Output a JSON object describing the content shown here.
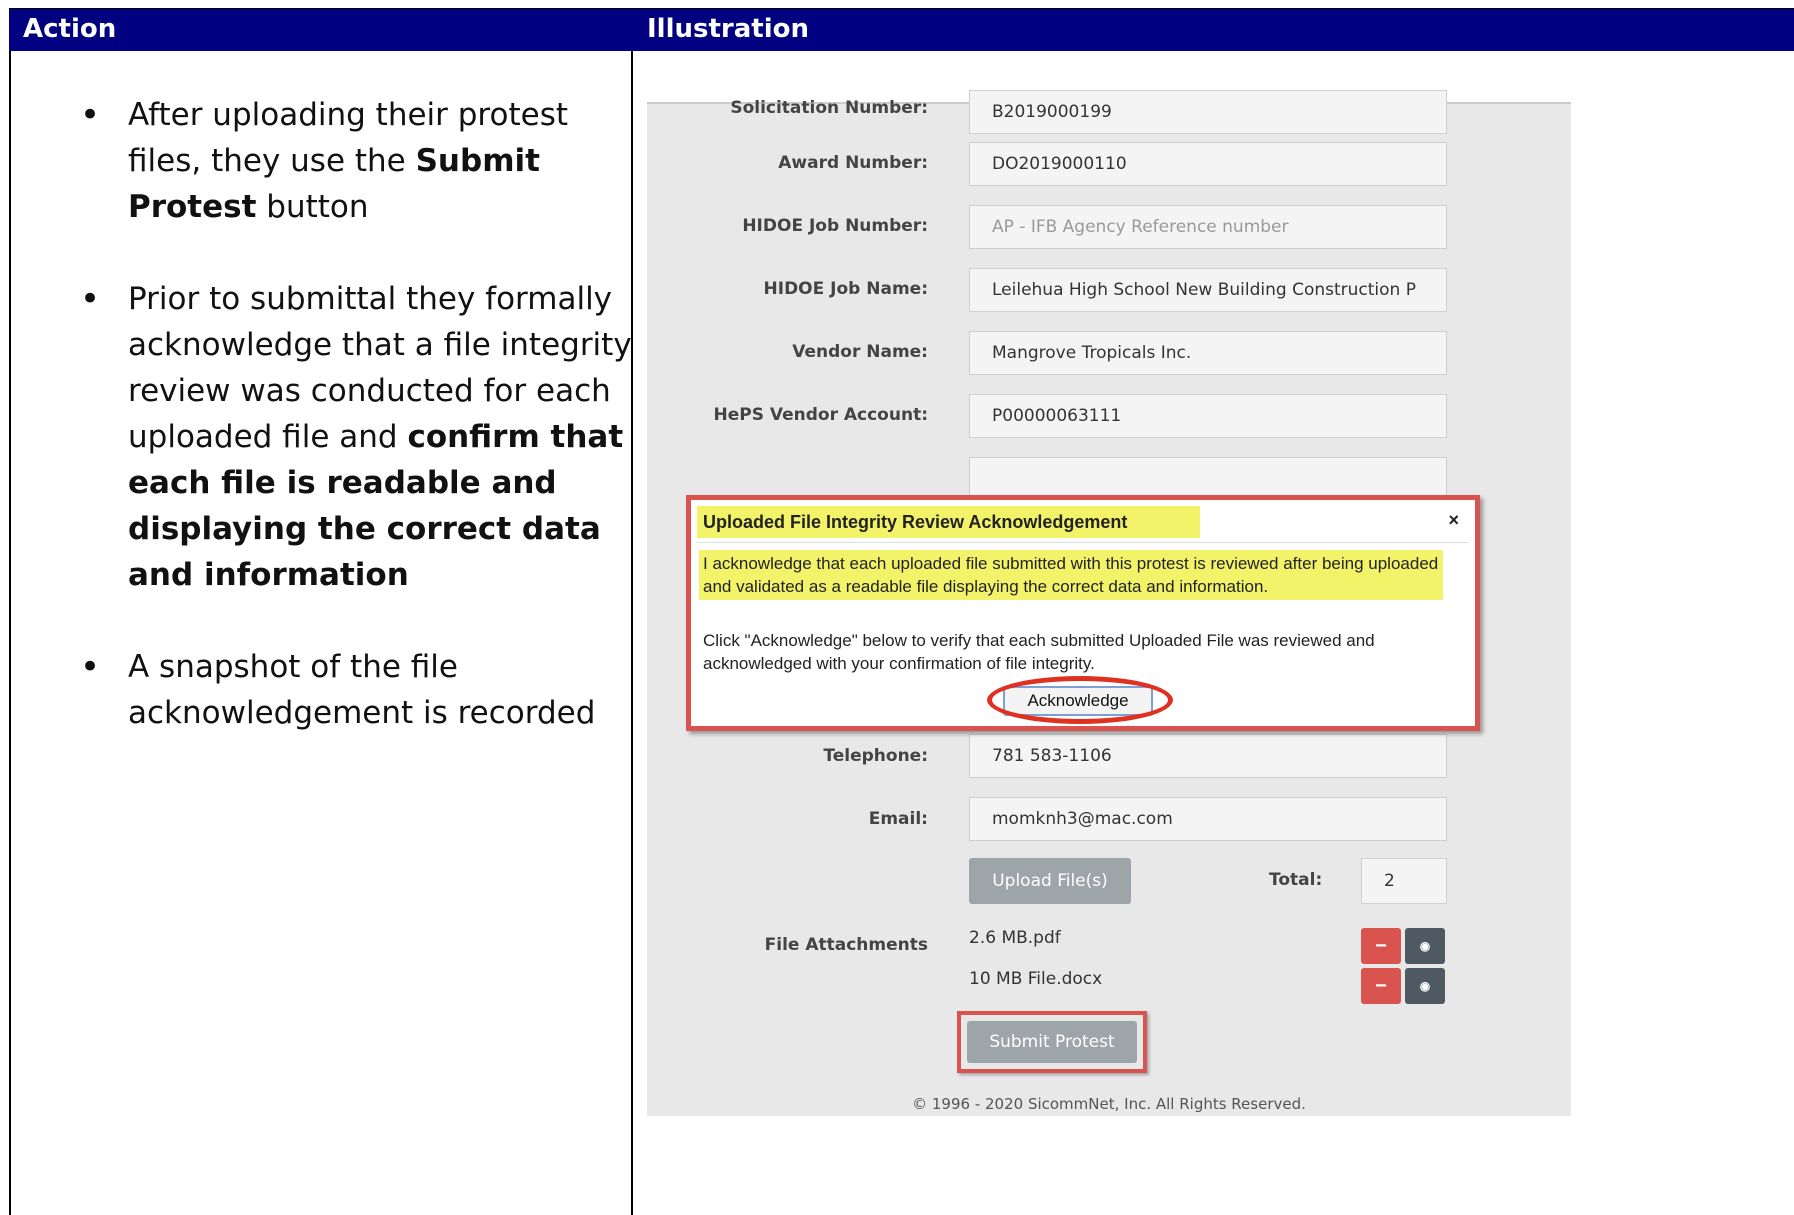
{
  "header": {
    "action": "Action",
    "illustration": "Illustration"
  },
  "bullets": {
    "b1": {
      "pre": "After uploading their protest files, they use the ",
      "bold": "Submit Protest",
      "post": " button"
    },
    "b2": {
      "pre": "Prior to submittal they formally acknowledge that a file integrity review was conducted for each uploaded file and ",
      "bold": "confirm that each file is readable and displaying the correct data and information"
    },
    "b3": {
      "text": "A snapshot of the file acknowledgement is recorded"
    }
  },
  "form": {
    "solicitation_label": "Solicitation Number:",
    "solicitation_value": "B2019000199",
    "award_label": "Award Number:",
    "award_value": "DO2019000110",
    "jobnum_label": "HIDOE Job Number:",
    "jobnum_placeholder": "AP - IFB Agency Reference number",
    "jobname_label": "HIDOE Job Name:",
    "jobname_value": "Leilehua High School New Building Construction P",
    "vendor_label": "Vendor Name:",
    "vendor_value": "Mangrove Tropicals Inc.",
    "heps_label": "HePS Vendor Account:",
    "heps_value": "P00000063111",
    "tel_label": "Telephone:",
    "tel_value": "781 583-1106",
    "email_label": "Email:",
    "email_value": "momknh3@mac.com",
    "upload_label": "Upload File(s)",
    "total_label": "Total:",
    "total_value": "2",
    "attachments_label": "File Attachments",
    "files": [
      "2.6 MB.pdf",
      "10 MB File.docx"
    ],
    "remove_glyph": "−",
    "view_glyph": "◉",
    "submit_label": "Submit Protest",
    "copyright": "© 1996 - 2020 SicommNet, Inc. All Rights Reserved."
  },
  "dialog": {
    "title": "Uploaded File Integrity Review Acknowledgement",
    "close": "×",
    "text1": "I acknowledge that each uploaded file submitted with this protest is reviewed after being uploaded and validated as a readable file displaying the correct data and information.",
    "text2": "Click \"Acknowledge\" below to verify that each submitted Uploaded File was reviewed and acknowledged with your confirmation of file integrity.",
    "button": "Acknowledge"
  },
  "colors": {
    "header_bg": "#000080",
    "highlight": "#f3f36a",
    "annotation_red": "#d9534f"
  }
}
